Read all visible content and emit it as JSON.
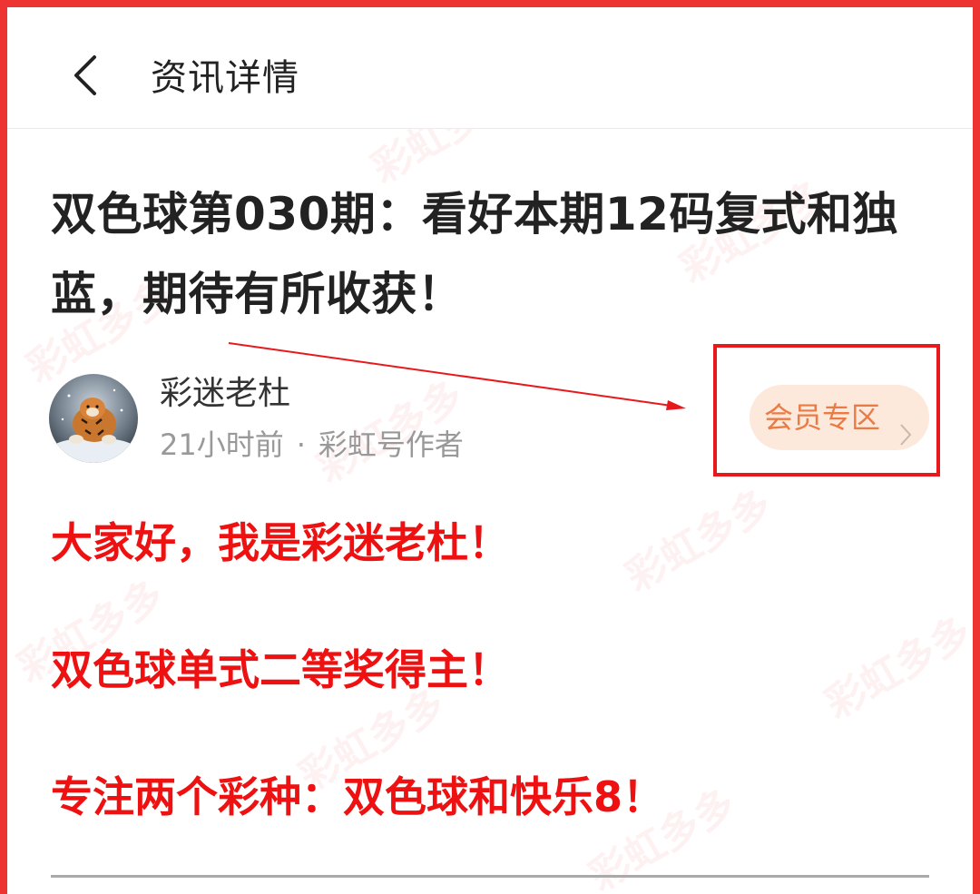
{
  "header": {
    "title": "资讯详情"
  },
  "article": {
    "title": "双色球第030期：看好本期12码复式和独蓝，期待有所收获！"
  },
  "author": {
    "name": "彩迷老杜",
    "time": "21小时前",
    "separator": "·",
    "role": "彩虹号作者",
    "member_button": "会员专区"
  },
  "body": {
    "paragraphs": [
      "大家好，我是彩迷老杜！",
      "双色球单式二等奖得主！",
      "专注两个彩种：双色球和快乐8！"
    ]
  },
  "watermark": {
    "text": "彩虹多多"
  },
  "colors": {
    "frame": "#ee3333",
    "highlight": "#ee1111",
    "member_bg": "#fde8dc",
    "member_text": "#ea7b45"
  },
  "icons": {
    "back": "chevron-left-icon",
    "member_chevron": "chevron-right-icon"
  }
}
